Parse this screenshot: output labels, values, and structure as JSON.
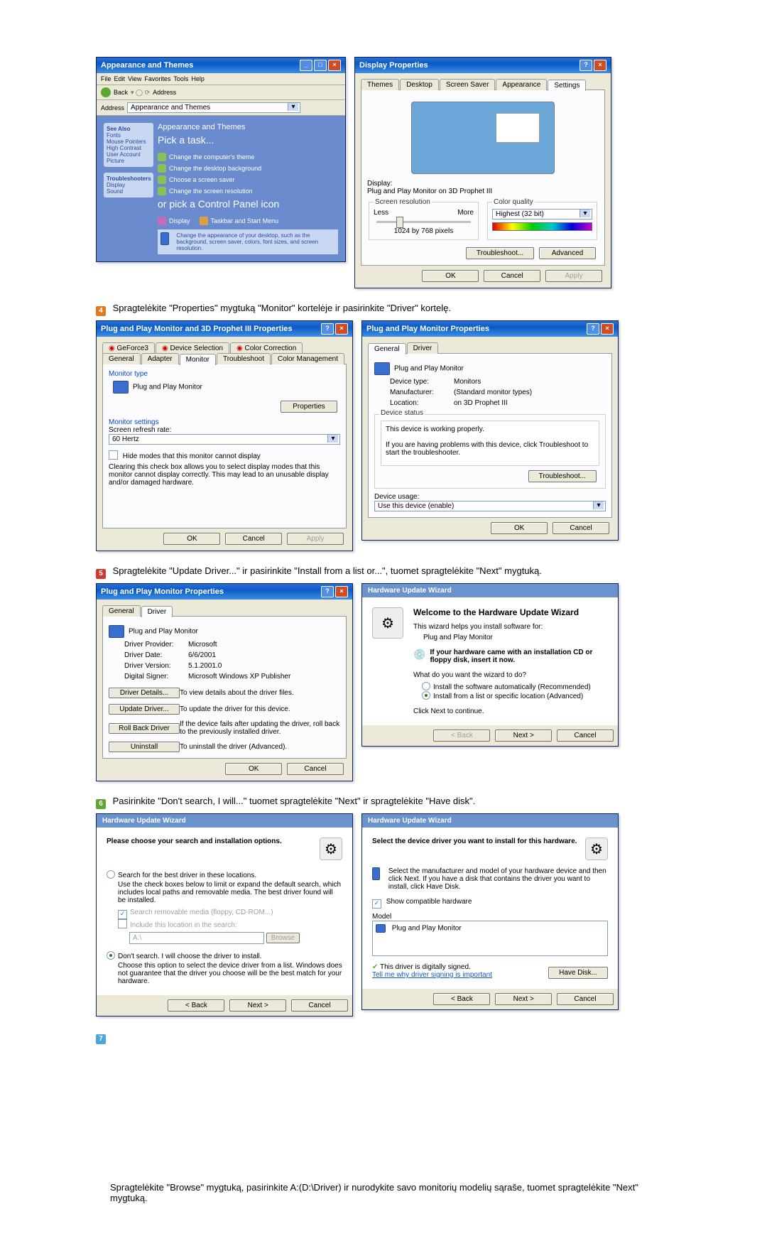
{
  "appearance": {
    "title": "Appearance and Themes",
    "breadcrumb_links": [
      "File",
      "Edit",
      "View",
      "Favorites",
      "Tools",
      "Help"
    ],
    "nav": {
      "back": "Back",
      "address_label": "Address",
      "address": "Appearance and Themes"
    },
    "side": {
      "see_also_header": "See Also",
      "see_also": [
        "Fonts",
        "Mouse Pointers",
        "High Contrast",
        "User Account Picture"
      ],
      "troubleshooters_header": "Troubleshooters",
      "troubleshooters": [
        "Display",
        "Sound"
      ]
    },
    "right": {
      "heading": "Appearance and Themes",
      "pick_task": "Pick a task...",
      "tasks": [
        "Change the computer's theme",
        "Change the desktop background",
        "Choose a screen saver",
        "Change the screen resolution"
      ],
      "or_pick": "or pick a Control Panel icon",
      "icons": [
        "Display",
        "Taskbar and Start Menu"
      ],
      "footer_hint": "Change the appearance of your desktop, such as the background, screen saver, colors, font sizes, and screen resolution."
    }
  },
  "display_props": {
    "title": "Display Properties",
    "tabs": [
      "Themes",
      "Desktop",
      "Screen Saver",
      "Appearance",
      "Settings"
    ],
    "active_tab": "Settings",
    "display_label": "Display:",
    "display_value": "Plug and Play Monitor on 3D Prophet III",
    "res_legend": "Screen resolution",
    "res_less": "Less",
    "res_more": "More",
    "res_value": "1024 by 768 pixels",
    "color_legend": "Color quality",
    "color_value": "Highest (32 bit)",
    "troubleshoot_btn": "Troubleshoot...",
    "advanced_btn": "Advanced",
    "ok": "OK",
    "cancel": "Cancel",
    "apply": "Apply"
  },
  "step4": {
    "text": "Spragtelėkite \"Properties\" mygtuką \"Monitor\" kortelėje ir pasirinkite \"Driver\" kortelę."
  },
  "adv_props": {
    "title": "Plug and Play Monitor and 3D Prophet III Properties",
    "tabs1": [
      "GeForce3",
      "Device Selection",
      "Color Correction"
    ],
    "tabs2": [
      "General",
      "Adapter",
      "Monitor",
      "Troubleshoot",
      "Color Management"
    ],
    "active_tab": "Monitor",
    "monitor_type_label": "Monitor type",
    "monitor_name": "Plug and Play Monitor",
    "properties_btn": "Properties",
    "monitor_settings_label": "Monitor settings",
    "refresh_label": "Screen refresh rate:",
    "refresh_value": "60 Hertz",
    "hide_modes_label": "Hide modes that this monitor cannot display",
    "hide_modes_text": "Clearing this check box allows you to select display modes that this monitor cannot display correctly. This may lead to an unusable display and/or damaged hardware.",
    "ok": "OK",
    "cancel": "Cancel",
    "apply": "Apply"
  },
  "mon_props": {
    "title": "Plug and Play Monitor Properties",
    "tabs": [
      "General",
      "Driver"
    ],
    "active_tab": "Driver",
    "gen": {
      "name": "Plug and Play Monitor",
      "device_type_l": "Device type:",
      "device_type_v": "Monitors",
      "mfr_l": "Manufacturer:",
      "mfr_v": "(Standard monitor types)",
      "loc_l": "Location:",
      "loc_v": "on 3D Prophet III",
      "status_legend": "Device status",
      "status1": "This device is working properly.",
      "status2": "If you are having problems with this device, click Troubleshoot to start the troubleshooter.",
      "troubleshoot": "Troubleshoot...",
      "usage_l": "Device usage:",
      "usage_v": "Use this device (enable)",
      "ok": "OK",
      "cancel": "Cancel"
    }
  },
  "step5": {
    "text": "Spragtelėkite \"Update Driver...\" ir pasirinkite \"Install from a list or...\", tuomet spragtelėkite \"Next\" mygtuką."
  },
  "drv_tab": {
    "title": "Plug and Play Monitor Properties",
    "tabs": [
      "General",
      "Driver"
    ],
    "name": "Plug and Play Monitor",
    "provider_l": "Driver Provider:",
    "provider_v": "Microsoft",
    "date_l": "Driver Date:",
    "date_v": "6/6/2001",
    "version_l": "Driver Version:",
    "version_v": "5.1.2001.0",
    "signer_l": "Digital Signer:",
    "signer_v": "Microsoft Windows XP Publisher",
    "btn_details": "Driver Details...",
    "btn_details_desc": "To view details about the driver files.",
    "btn_update": "Update Driver...",
    "btn_update_desc": "To update the driver for this device.",
    "btn_rollback": "Roll Back Driver",
    "btn_rollback_desc": "If the device fails after updating the driver, roll back to the previously installed driver.",
    "btn_uninstall": "Uninstall",
    "btn_uninstall_desc": "To uninstall the driver (Advanced).",
    "ok": "OK",
    "cancel": "Cancel"
  },
  "hw_wiz1": {
    "title": "Hardware Update Wizard",
    "heading": "Welcome to the Hardware Update Wizard",
    "line1": "This wizard helps you install software for:",
    "device": "Plug and Play Monitor",
    "cd_hint": "If your hardware came with an installation CD or floppy disk, insert it now.",
    "q": "What do you want the wizard to do?",
    "opt1": "Install the software automatically (Recommended)",
    "opt2": "Install from a list or specific location (Advanced)",
    "cont": "Click Next to continue.",
    "back": "< Back",
    "next": "Next >",
    "cancel": "Cancel"
  },
  "step6": {
    "text": "Pasirinkite \"Don't search, I will...\" tuomet spragtelėkite \"Next\" ir spragtelėkite \"Have disk\"."
  },
  "hw_wiz2": {
    "title": "Hardware Update Wizard",
    "heading": "Please choose your search and installation options.",
    "opt_search": "Search for the best driver in these locations.",
    "search_hint": "Use the check boxes below to limit or expand the default search, which includes local paths and removable media. The best driver found will be installed.",
    "chk1": "Search removable media (floppy, CD-ROM...)",
    "chk2": "Include this location in the search:",
    "path": "A:\\",
    "browse": "Browse",
    "opt_dontsearch": "Don't search. I will choose the driver to install.",
    "dont_hint": "Choose this option to select the device driver from a list. Windows does not guarantee that the driver you choose will be the best match for your hardware.",
    "back": "< Back",
    "next": "Next >",
    "cancel": "Cancel"
  },
  "hw_wiz3": {
    "title": "Hardware Update Wizard",
    "heading": "Select the device driver you want to install for this hardware.",
    "hint": "Select the manufacturer and model of your hardware device and then click Next. If you have a disk that contains the driver you want to install, click Have Disk.",
    "show_compat": "Show compatible hardware",
    "model_label": "Model",
    "model_item": "Plug and Play Monitor",
    "signed": "This driver is digitally signed.",
    "why": "Tell me why driver signing is important",
    "have_disk": "Have Disk...",
    "back": "< Back",
    "next": "Next >",
    "cancel": "Cancel"
  },
  "step7": {
    "text": "Spragtelėkite \"Browse\" mygtuką, pasirinkite A:(D:\\Driver) ir nurodykite savo monitorių modelių sąraše, tuomet spragtelėkite \"Next\" mygtuką."
  }
}
